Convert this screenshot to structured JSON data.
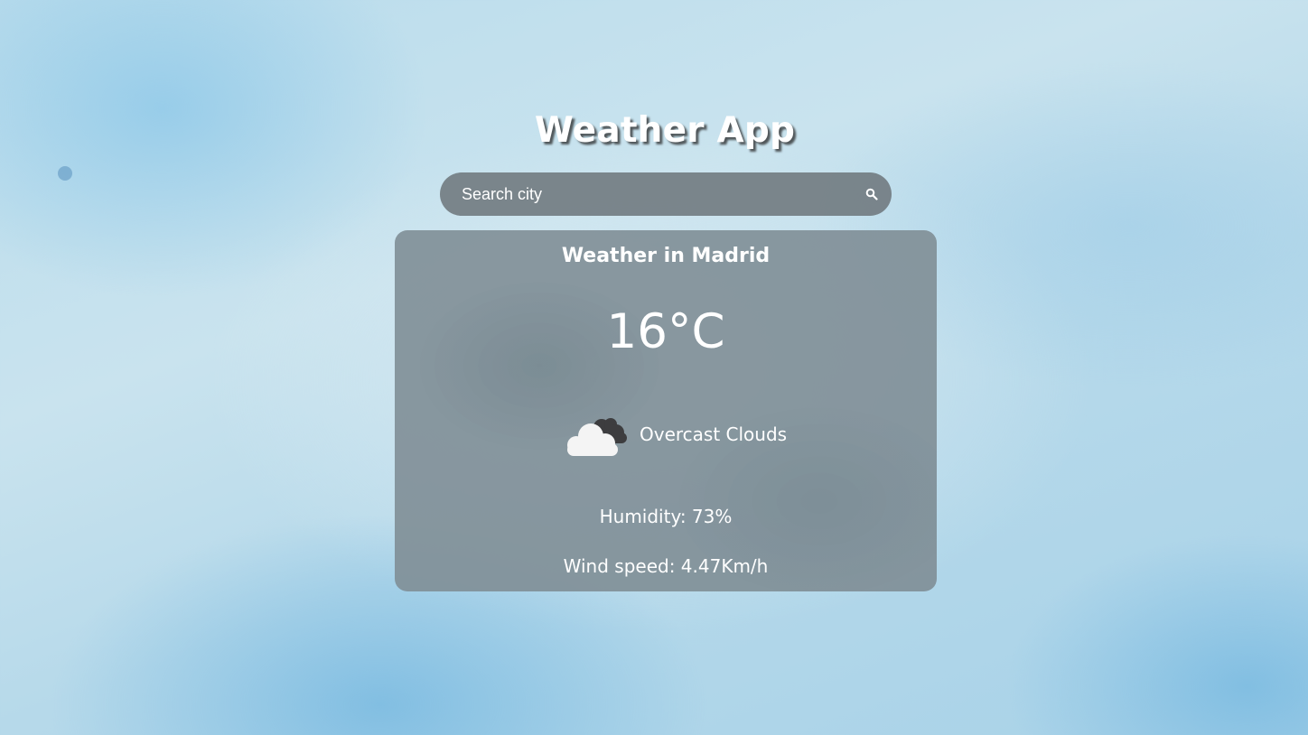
{
  "app": {
    "title": "Weather App"
  },
  "search": {
    "placeholder": "Search city",
    "value": "",
    "icon": "search-icon"
  },
  "weather": {
    "heading": "Weather in Madrid",
    "temperature": "16°C",
    "condition_icon": "overcast-clouds-icon",
    "condition": "Overcast Clouds",
    "humidity": "Humidity: 73%",
    "wind_speed": "Wind speed: 4.47Km/h"
  },
  "colors": {
    "text": "#ffffff",
    "card_bg": "#808e96",
    "search_bg": "#6e787d",
    "sky": "#b9dcec"
  }
}
